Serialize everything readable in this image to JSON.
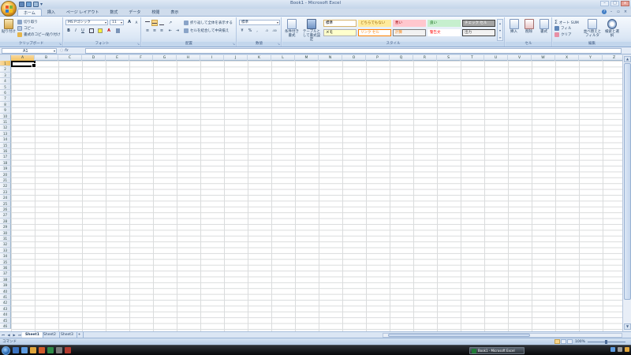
{
  "window": {
    "title": "Book1 - Microsoft Excel",
    "controls": {
      "minimize": "–",
      "maximize": "□",
      "close": "x"
    },
    "help": "?"
  },
  "tabs": [
    {
      "label": "ホーム",
      "active": true
    },
    {
      "label": "挿入"
    },
    {
      "label": "ページ レイアウト"
    },
    {
      "label": "数式"
    },
    {
      "label": "データ"
    },
    {
      "label": "校閲"
    },
    {
      "label": "表示"
    }
  ],
  "ribbon": {
    "clipboard": {
      "label": "クリップボード",
      "paste": "貼り付け",
      "cut": "切り取り",
      "copy": "コピー",
      "format_painter": "書式のコピー/貼り付け"
    },
    "font": {
      "label": "フォント",
      "font_name": "MS Pゴシック",
      "font_size": "11",
      "bold": "B",
      "italic": "I",
      "underline": "U",
      "grow": "A",
      "shrink": "A",
      "font_color": "A"
    },
    "alignment": {
      "label": "配置",
      "wrap_text": "折り返して全体を表示する",
      "merge_center": "セルを結合して中央揃え"
    },
    "number": {
      "label": "数値",
      "format": "標準",
      "currency": "¥",
      "percent": "%",
      "comma": ","
    },
    "styles": {
      "label": "スタイル",
      "conditional": "条件付き書式",
      "as_table": "テーブルとして書式設定",
      "cells": [
        {
          "label": "標準",
          "bg": "#ffffff",
          "fg": "#000000",
          "border": "#d6b36c"
        },
        {
          "label": "どちらでもない",
          "bg": "#ffeb9c",
          "fg": "#9c6500",
          "border": "#ffeb9c"
        },
        {
          "label": "悪い",
          "bg": "#ffc7ce",
          "fg": "#9c0006",
          "border": "#ffc7ce"
        },
        {
          "label": "良い",
          "bg": "#c6efce",
          "fg": "#006100",
          "border": "#c6efce"
        },
        {
          "label": "チェック セル",
          "bg": "#a5a5a5",
          "fg": "#ffffff",
          "border": "#3f3f3f"
        },
        {
          "label": "メモ",
          "bg": "#ffffcc",
          "fg": "#000000",
          "border": "#b2b2b2"
        },
        {
          "label": "リンク セル",
          "bg": "#ffffff",
          "fg": "#fa7d00",
          "border": "#ff8001"
        },
        {
          "label": "計算",
          "bg": "#f2f2f2",
          "fg": "#fa7d00",
          "border": "#7f7f7f"
        },
        {
          "label": "警告文",
          "bg": "#ffffff",
          "fg": "#ff0000",
          "border": "#ffffff"
        },
        {
          "label": "出力",
          "bg": "#f2f2f2",
          "fg": "#3f3f3f",
          "border": "#3f3f3f"
        }
      ]
    },
    "cells": {
      "label": "セル",
      "insert": "挿入",
      "delete": "削除",
      "format": "書式"
    },
    "editing": {
      "label": "編集",
      "autosum": "オート SUM",
      "fill": "フィル",
      "clear": "クリア",
      "sort": "並べ替えとフィルタ",
      "find": "検索と選択"
    }
  },
  "formula_bar": {
    "name_box": "A1",
    "fx": "fx",
    "value": ""
  },
  "grid": {
    "columns": [
      "A",
      "B",
      "C",
      "D",
      "E",
      "F",
      "G",
      "H",
      "I",
      "J",
      "K",
      "L",
      "M",
      "N",
      "O",
      "P",
      "Q",
      "R",
      "S",
      "T",
      "U",
      "V",
      "W",
      "X",
      "Y",
      "Z"
    ],
    "rows": [
      "1",
      "2",
      "3",
      "4",
      "5",
      "6",
      "7",
      "8",
      "9",
      "10",
      "11",
      "12",
      "13",
      "14",
      "15",
      "16",
      "17",
      "18",
      "19",
      "20",
      "21",
      "22",
      "23",
      "24",
      "25",
      "26",
      "27",
      "28",
      "29",
      "30",
      "31",
      "32",
      "33",
      "34",
      "35",
      "36",
      "37",
      "38",
      "39",
      "40",
      "41",
      "42",
      "43",
      "44",
      "45",
      "46"
    ],
    "active_cell": "A1"
  },
  "sheets": {
    "tabs": [
      "Sheet1",
      "Sheet2",
      "Sheet3"
    ],
    "active": "Sheet1",
    "add": "+"
  },
  "status": {
    "text": "コマンド",
    "zoom": "100%"
  }
}
